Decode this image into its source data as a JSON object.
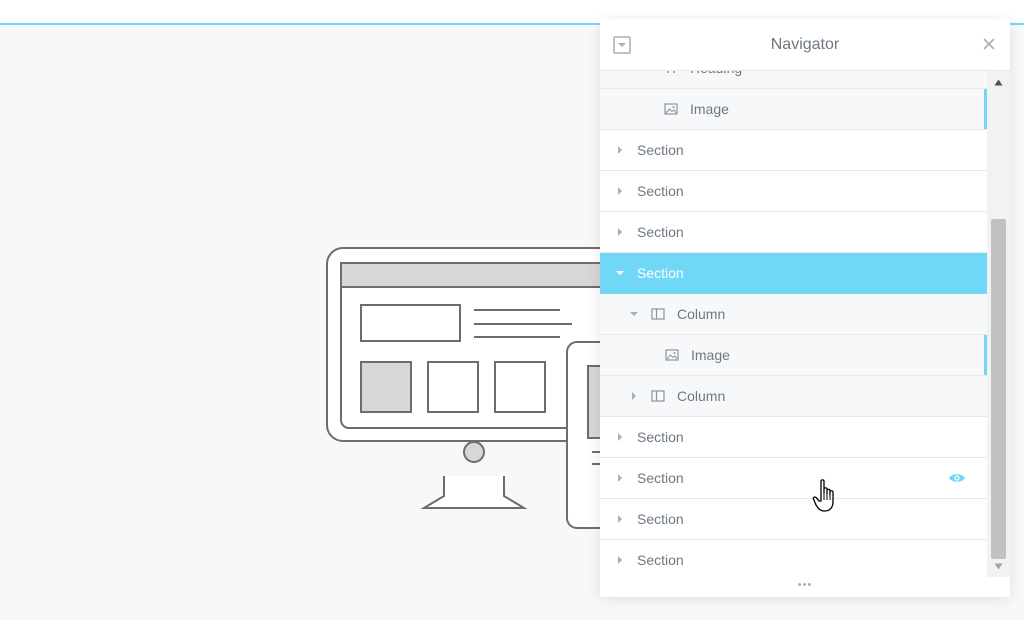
{
  "navigator": {
    "title": "Navigator",
    "collapse_icon": "collapse-square-icon",
    "close_icon": "close-icon",
    "resize_handle": "•••",
    "rows": [
      {
        "label": "Heading",
        "type": "heading",
        "level": 2,
        "icon": "heading-icon",
        "partially_visible": true
      },
      {
        "label": "Image",
        "type": "widget",
        "level": 2,
        "icon": "image-icon",
        "indicator": true
      },
      {
        "label": "Section",
        "type": "section",
        "level": 0,
        "toggle": "collapsed"
      },
      {
        "label": "Section",
        "type": "section",
        "level": 0,
        "toggle": "collapsed"
      },
      {
        "label": "Section",
        "type": "section",
        "level": 0,
        "toggle": "collapsed"
      },
      {
        "label": "Section",
        "type": "section",
        "level": 0,
        "toggle": "expanded",
        "selected": true
      },
      {
        "label": "Column",
        "type": "column",
        "level": 1,
        "icon": "column-icon",
        "toggle": "expanded"
      },
      {
        "label": "Image",
        "type": "widget",
        "level": 2,
        "icon": "image-icon",
        "indicator": true
      },
      {
        "label": "Column",
        "type": "column",
        "level": 1,
        "icon": "column-icon",
        "toggle": "collapsed"
      },
      {
        "label": "Section",
        "type": "section",
        "level": 0,
        "toggle": "collapsed"
      },
      {
        "label": "Section",
        "type": "section",
        "level": 0,
        "toggle": "collapsed",
        "hover_icon": "eye-icon"
      },
      {
        "label": "Section",
        "type": "section",
        "level": 0,
        "toggle": "collapsed"
      },
      {
        "label": "Section",
        "type": "section",
        "level": 0,
        "toggle": "collapsed"
      }
    ]
  },
  "colors": {
    "accent": "#71d7f7",
    "text": "#6d7882",
    "canvas": "#f7f8fa"
  },
  "illustration": "devices-illustration",
  "cursor": "hand-pointer-cursor"
}
